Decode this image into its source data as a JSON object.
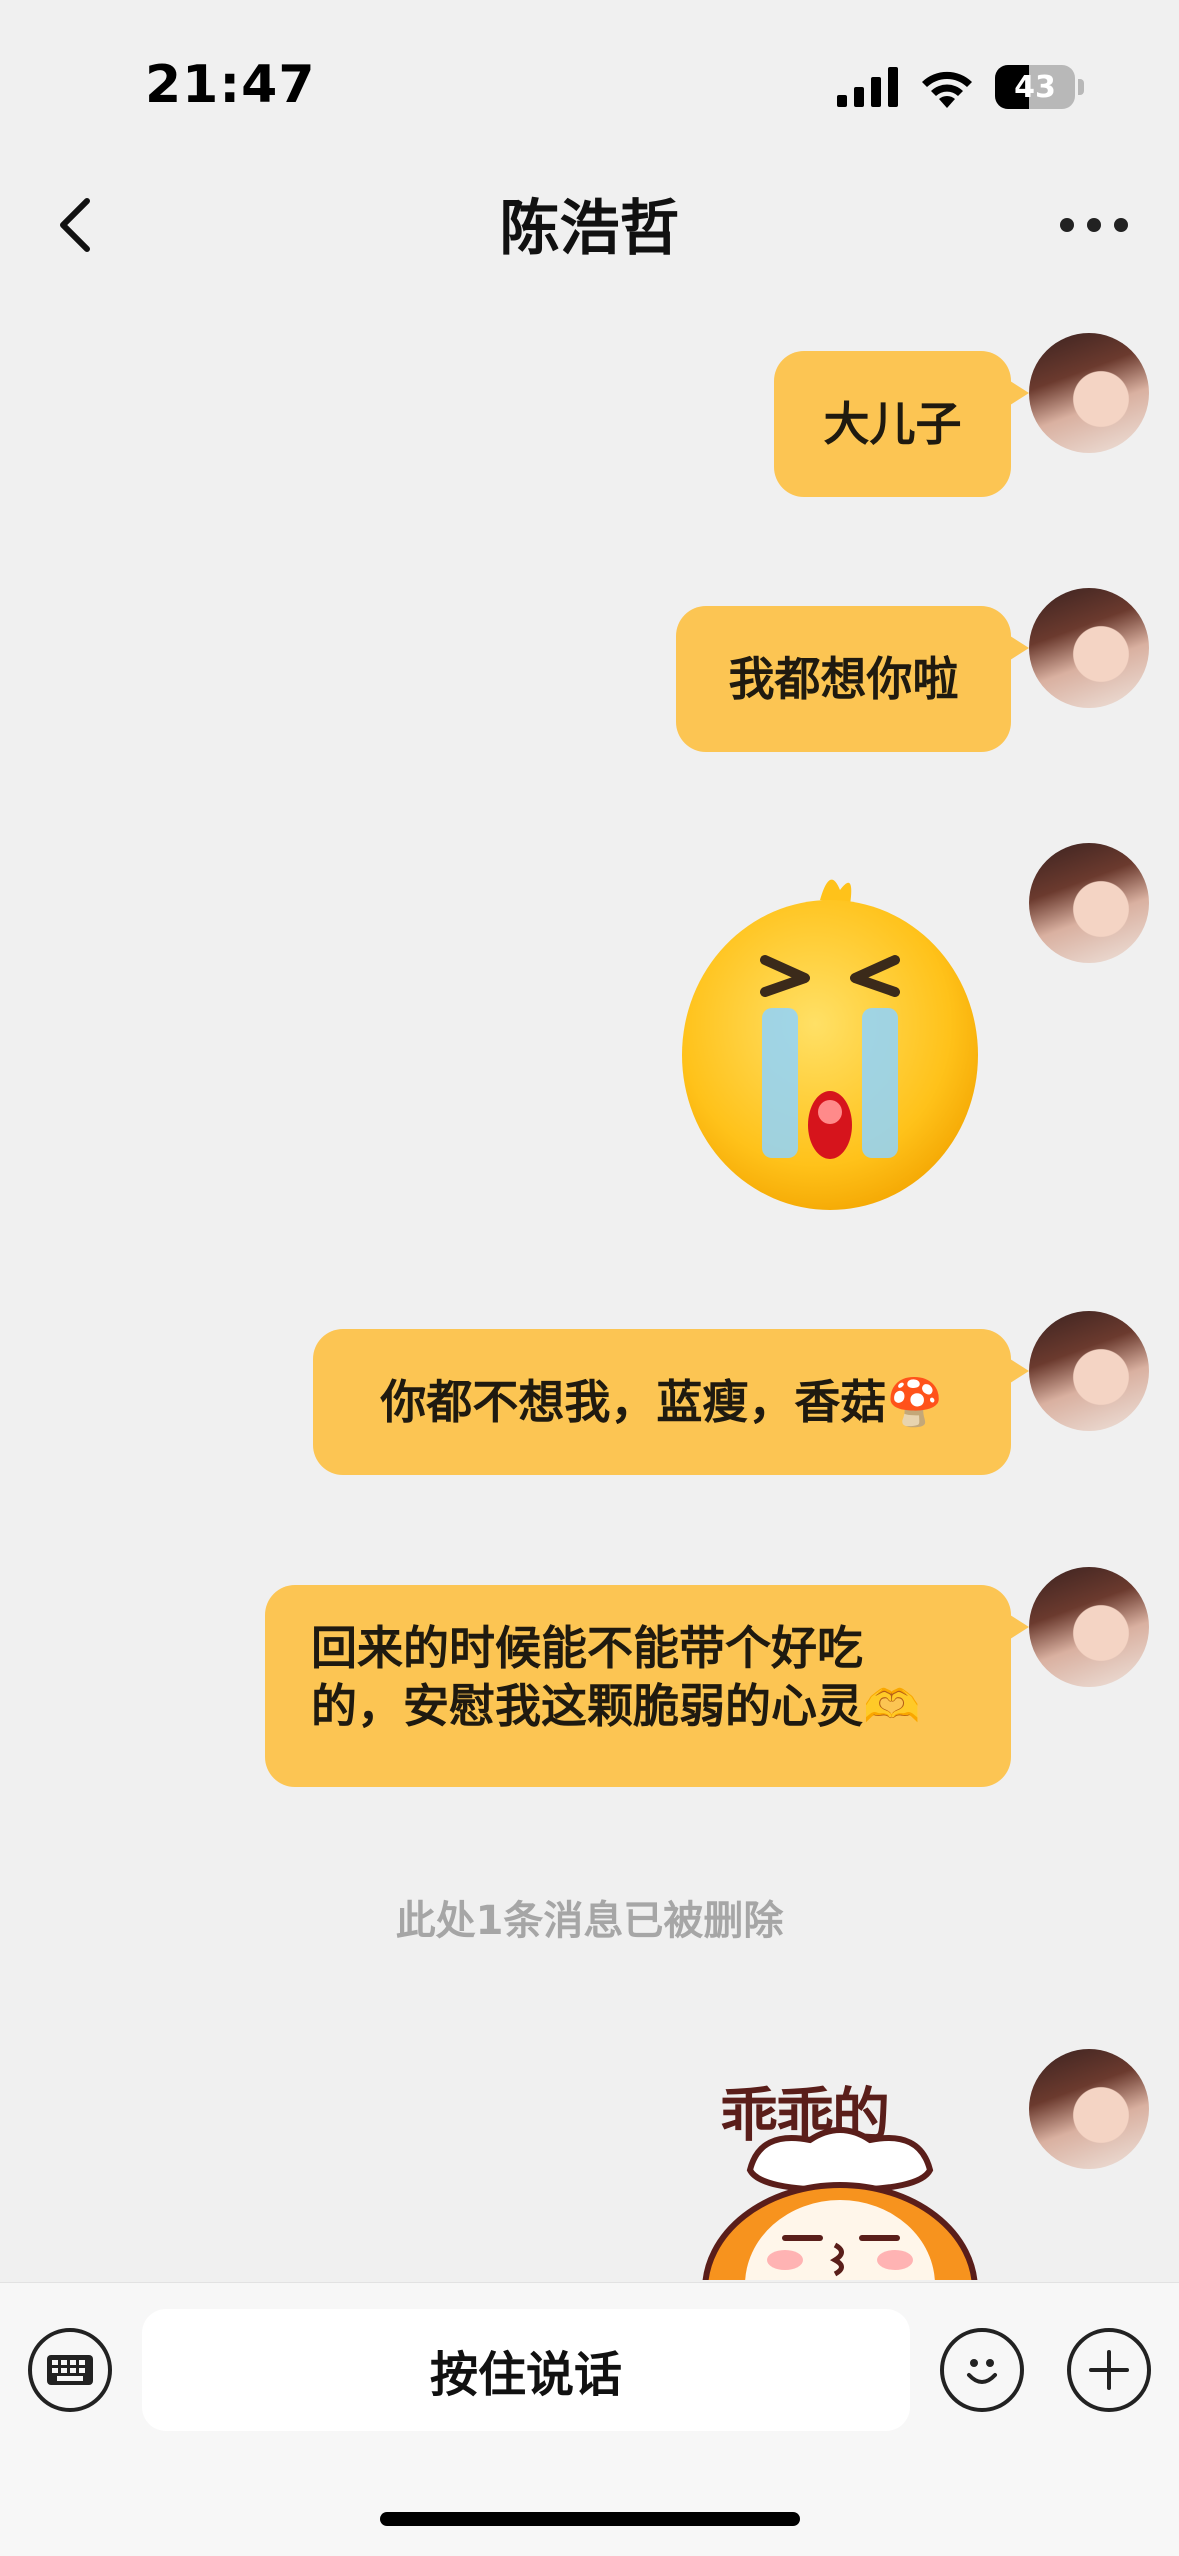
{
  "status": {
    "time": "21:47",
    "battery": "43"
  },
  "nav": {
    "title": "陈浩哲"
  },
  "messages": [
    {
      "text": "大儿子"
    },
    {
      "text": "我都想你啦"
    },
    {
      "text": "你都不想我，蓝瘦，香菇🍄"
    },
    {
      "line1": "回来的时候能不能带个好吃",
      "line2": "的，安慰我这颗脆弱的心灵🫶"
    }
  ],
  "deleted_note": "此处1条消息已被删除",
  "sticker": {
    "caption": "乖乖的"
  },
  "input": {
    "hold_to_talk": "按住说话"
  },
  "colors": {
    "bubble": "#fcc553",
    "background": "#f0f0f0"
  }
}
